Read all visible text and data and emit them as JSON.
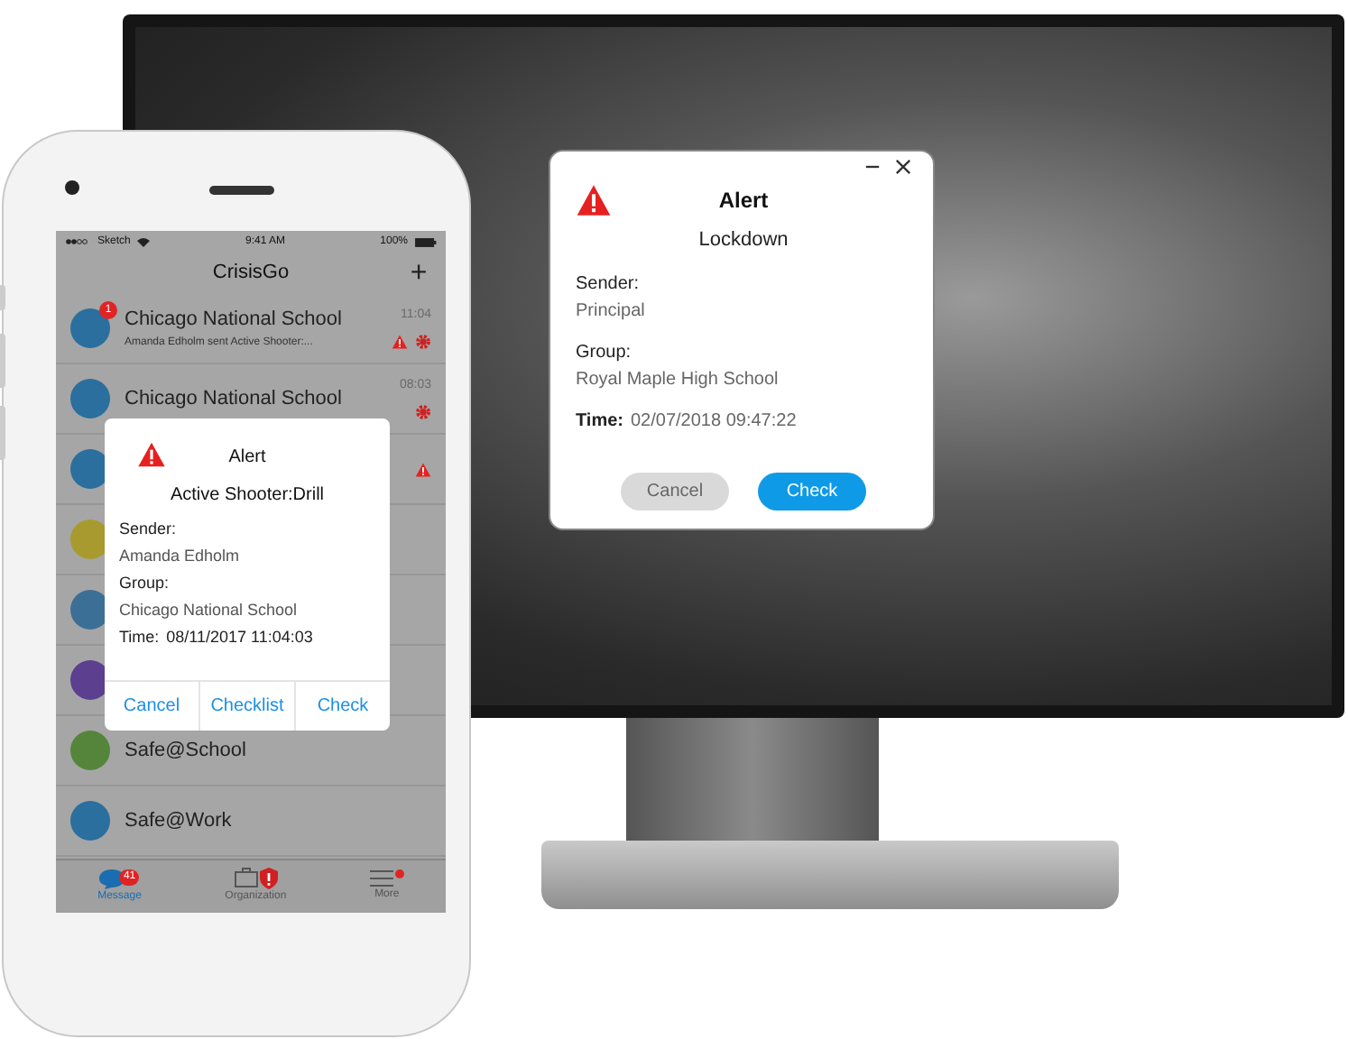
{
  "desktop_alert": {
    "title": "Alert",
    "subtitle": "Lockdown",
    "fields": [
      {
        "kind": "stacked",
        "label": "Sender:",
        "value": "Principal"
      },
      {
        "kind": "stacked",
        "label": "Group:",
        "value": "Royal Maple High School"
      },
      {
        "kind": "inline",
        "label": "Time:",
        "value": "02/07/2018 09:47:22"
      }
    ],
    "buttons": [
      {
        "kind": "secondary",
        "label": "Cancel"
      },
      {
        "kind": "primary",
        "label": "Check"
      }
    ]
  },
  "phone": {
    "status_bar": {
      "carrier": "Sketch",
      "time": "9:41 AM",
      "battery": "100%"
    },
    "app_title": "CrisisGo",
    "add_button": "+",
    "chats": [
      {
        "name": "Chicago National School",
        "preview": "Amanda Edholm sent Active Shooter:...",
        "time": "11:04",
        "badge": "1",
        "color": "#2a6f9e",
        "warning": true,
        "gear": true
      },
      {
        "name": "Chicago National School",
        "time": "08:03",
        "color": "#2a6f9e",
        "warning": false,
        "gear": true
      },
      {
        "color": "#2a6f9e",
        "warning": true,
        "gear": false
      },
      {
        "color": "#a89a2e",
        "warning": false,
        "gear": false
      },
      {
        "color": "#3c6f96",
        "warning": false,
        "gear": false
      },
      {
        "color": "#5c3f8f",
        "warning": false,
        "gear": false
      },
      {
        "name": "Safe@School",
        "color": "#55853a",
        "warning": false,
        "gear": false
      },
      {
        "name": "Safe@Work",
        "color": "#2a6f9e",
        "warning": false,
        "gear": false
      }
    ],
    "alert": {
      "title": "Alert",
      "subtitle": "Active Shooter:Drill",
      "fields": [
        {
          "kind": "stacked",
          "label": "Sender:",
          "value": "Amanda Edholm"
        },
        {
          "kind": "stacked",
          "label": "Group:",
          "value": "Chicago National School"
        },
        {
          "kind": "inline",
          "label": "Time:",
          "value": "08/11/2017 11:04:03"
        }
      ],
      "buttons": [
        "Cancel",
        "Checklist",
        "Check"
      ]
    },
    "tabs": [
      {
        "label": "Message",
        "selected": true,
        "badge": "41"
      },
      {
        "label": "Organization",
        "selected": false,
        "alert": true
      },
      {
        "label": "More",
        "selected": false,
        "dot": true
      }
    ]
  }
}
